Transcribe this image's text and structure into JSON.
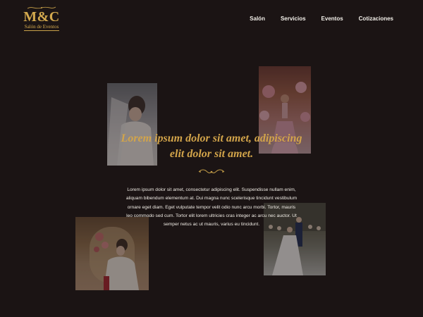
{
  "logo": {
    "mark": "M&C",
    "subtitle": "Salón de Eventos"
  },
  "nav": {
    "items": [
      {
        "label": "Salón"
      },
      {
        "label": "Servicios"
      },
      {
        "label": "Eventos"
      },
      {
        "label": "Cotizaciones"
      }
    ]
  },
  "hero": {
    "headline_line1": "Lorem ipsum dolor sit amet, adipiscing",
    "headline_line2": "elit dolor sit amet.",
    "body": "Lorem ipsum dolor sit amet, consectetur adipiscing elit. Suspendisse nullam enim, aliquam bibendum elementum at. Dui magna nunc scelerisque tincidunt vestibulum ornare eget diam. Eget vulputate tempor velit odio nunc arcu morbi. Tortor, mauris leo commodo sed cum. Tortor elit lorem ultricies cras integer ac arcu nec auctor. Ut semper netus ac ut mauris, varius eu tincidunt."
  },
  "colors": {
    "background": "#1b1414",
    "accent_gold": "#d2a44a",
    "nav_text": "#f2efe9",
    "body_text": "#f1ede6"
  },
  "icons": {
    "logo_ornament": "flourish-icon",
    "divider_ornament": "flourish-divider-icon"
  }
}
